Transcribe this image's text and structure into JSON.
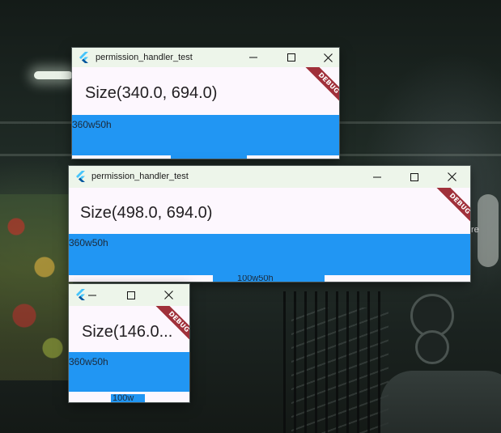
{
  "wallpaper": {
    "text_fragment": "re"
  },
  "windows": [
    {
      "id": "window-1",
      "title": "permission_handler_test",
      "size_text": "Size(340.0, 694.0)",
      "bar_label": "360w50h",
      "debug_label": "DEBUG"
    },
    {
      "id": "window-2",
      "title": "permission_handler_test",
      "size_text": "Size(498.0, 694.0)",
      "bar_label": "360w50h",
      "bottom_label": "100w50h",
      "debug_label": "DEBUG"
    },
    {
      "id": "window-3",
      "size_text": "Size(146.0...",
      "bar_label": "360w50h",
      "bottom_label": "100w",
      "debug_label": "DEBUG"
    }
  ],
  "icons": {
    "app": "flutter-icon",
    "minimize": "minimize-icon",
    "maximize": "maximize-icon",
    "close": "close-icon"
  },
  "colors": {
    "titlebar": "#edf5ea",
    "window_bg": "#fdf7fe",
    "bar": "#2196f3",
    "debug_banner": "#a0303a"
  }
}
